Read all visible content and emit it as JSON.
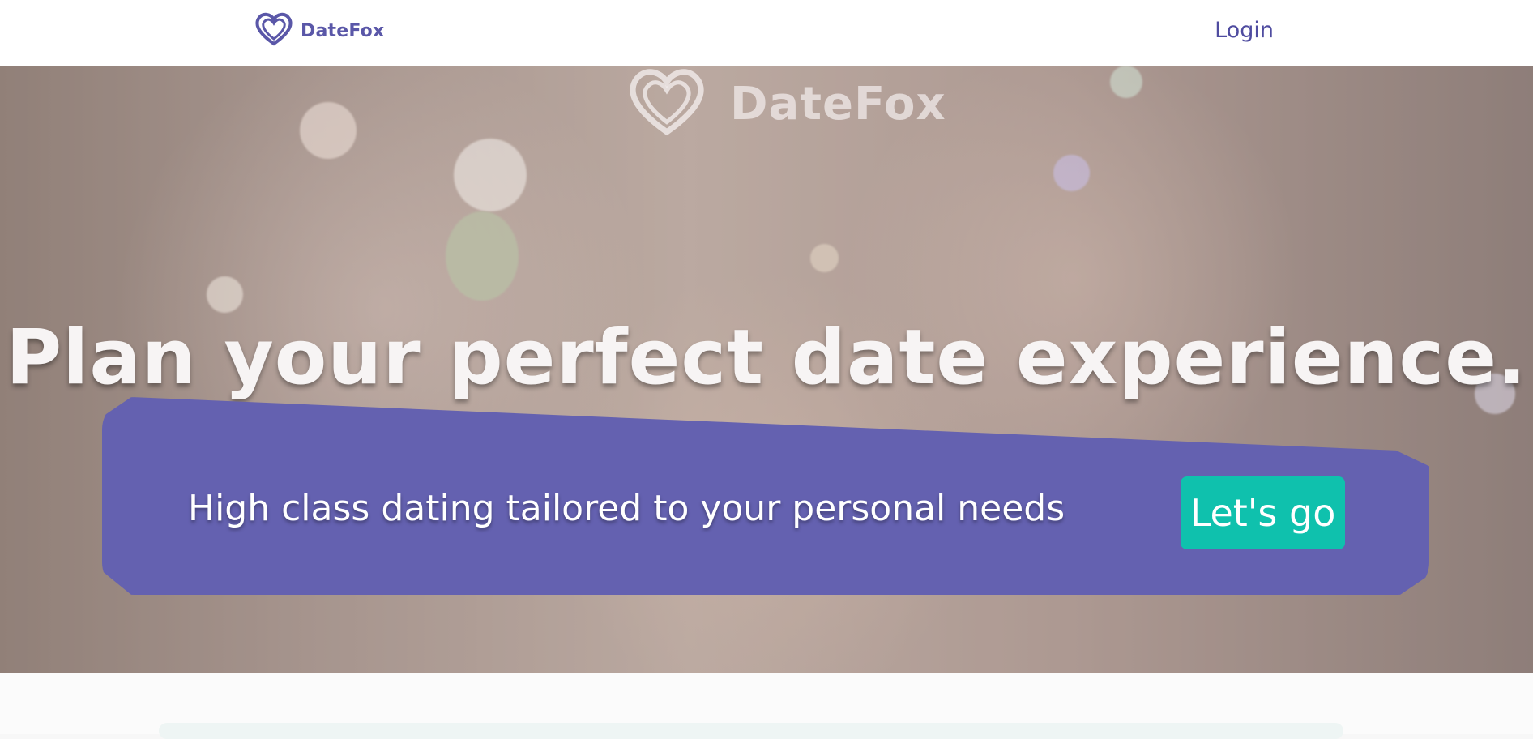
{
  "nav": {
    "brand": "DateFox",
    "login_label": "Login"
  },
  "hero": {
    "logo_text": "DateFox",
    "headline": "Plan your perfect date experience.",
    "tagline": "High class dating tailored to your personal needs",
    "cta_label": "Let's go"
  },
  "icons": {
    "logo": "heart-icon"
  },
  "colors": {
    "brand": "#5a57a8",
    "panel": "#6461b0",
    "cta": "#0fc1ad"
  }
}
